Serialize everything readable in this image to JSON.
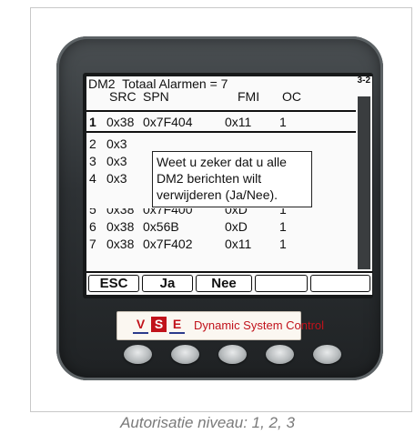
{
  "screen": {
    "title_line": "DM2  Totaal Alarmen = 7",
    "page_indicator": "3-2",
    "columns": [
      "SRC",
      "SPN",
      "FMI",
      "OC"
    ],
    "rows": [
      {
        "idx": "1",
        "src": "0x38",
        "spn": "0x7F404",
        "fmi": "0x11",
        "oc": "1"
      },
      {
        "idx": "2",
        "src": "0x3",
        "spn": "",
        "fmi": "",
        "oc": ""
      },
      {
        "idx": "3",
        "src": "0x3",
        "spn": "",
        "fmi": "",
        "oc": ""
      },
      {
        "idx": "4",
        "src": "0x3",
        "spn": "",
        "fmi": "",
        "oc": ""
      },
      {
        "idx": "5",
        "src": "0x38",
        "spn": "0x7F400",
        "fmi": "0xD",
        "oc": "1"
      },
      {
        "idx": "6",
        "src": "0x38",
        "spn": "0x56B",
        "fmi": "0xD",
        "oc": "1"
      },
      {
        "idx": "7",
        "src": "0x38",
        "spn": "0x7F402",
        "fmi": "0x11",
        "oc": "1"
      }
    ],
    "dialog": {
      "lines": [
        "Weet u zeker dat u alle",
        "DM2 berichten wilt",
        "verwijderen (Ja/Nee)."
      ]
    },
    "softkeys": [
      "ESC",
      "Ja",
      "Nee",
      "",
      ""
    ]
  },
  "logo": {
    "letters": [
      "V",
      "S",
      "E"
    ],
    "text": "Dynamic System Control",
    "color": "#c1121b"
  },
  "buttons": [
    "hw-button-1",
    "hw-button-2",
    "hw-button-3",
    "hw-button-4",
    "hw-button-5"
  ],
  "caption": "Autorisatie niveau: 1, 2, 3"
}
